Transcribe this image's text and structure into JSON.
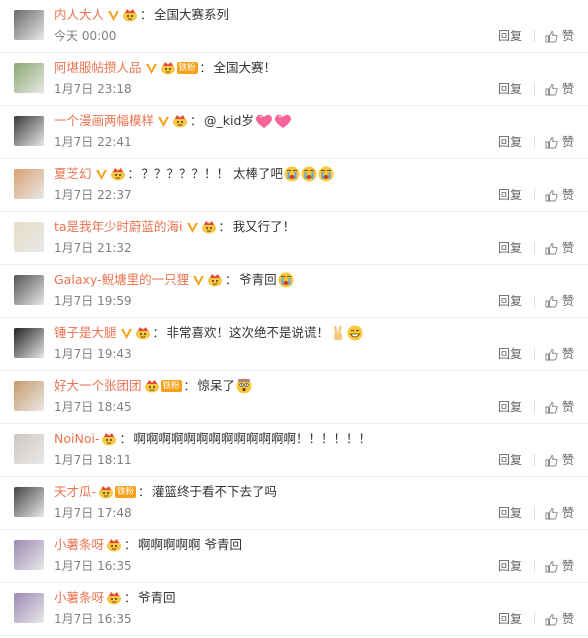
{
  "actions": {
    "reply_label": "回复",
    "like_label": "赞"
  },
  "colors": {
    "username": "#eb7350",
    "verified": "#f7a11b",
    "fan_badge": "#f7a11b"
  },
  "comments": [
    {
      "user": "内人大人",
      "verified": true,
      "crown": true,
      "fan_badge": "",
      "text": "全国大赛系列",
      "emojis": [],
      "time": "今天 00:00",
      "avatar_color": "#6b6b6b"
    },
    {
      "user": "阿堪服帖攒人品",
      "verified": true,
      "crown": true,
      "fan_badge": "铁粉",
      "text": "全国大赛！",
      "emojis": [],
      "time": "1月7日 23:18",
      "avatar_color": "#8aa86f"
    },
    {
      "user": "一个漫画两幅模样",
      "verified": true,
      "crown": true,
      "fan_badge": "",
      "text": "@_kid岁",
      "emojis": [
        "heart",
        "heart"
      ],
      "time": "1月7日 22:41",
      "avatar_color": "#3a3a3a"
    },
    {
      "user": "夏芝幻",
      "verified": true,
      "crown": true,
      "fan_badge": "",
      "text": "？？？？？！！ 太棒了吧",
      "emojis": [
        "cry",
        "cry",
        "cry"
      ],
      "time": "1月7日 22:37",
      "avatar_color": "#d9a070"
    },
    {
      "user": "ta是我年少时蔚蓝的海i",
      "verified": true,
      "crown": true,
      "fan_badge": "",
      "text": "我又行了！",
      "emojis": [],
      "time": "1月7日 21:32",
      "avatar_color": "#e6dcc6"
    },
    {
      "user": "Galaxy-鲵塘里的一只狸",
      "verified": true,
      "crown": true,
      "fan_badge": "",
      "text": "爷青回",
      "emojis": [
        "cry"
      ],
      "time": "1月7日 19:59",
      "avatar_color": "#555555"
    },
    {
      "user": "锤子是大腿",
      "verified": true,
      "crown": true,
      "fan_badge": "",
      "text": "非常喜欢！这次绝不是说谎！",
      "emojis": [
        "victory",
        "grin"
      ],
      "time": "1月7日 19:43",
      "avatar_color": "#222222"
    },
    {
      "user": "好大一个张团团",
      "verified": false,
      "crown": true,
      "fan_badge": "铁粉",
      "text": "惊呆了",
      "emojis": [
        "shock"
      ],
      "time": "1月7日 18:45",
      "avatar_color": "#c89a6a"
    },
    {
      "user": "NoiNoi-",
      "verified": false,
      "crown": true,
      "fan_badge": "",
      "text": "啊啊啊啊啊啊啊啊啊啊啊啊啊！！！！！！",
      "emojis": [],
      "time": "1月7日 18:11",
      "avatar_color": "#cfc8c0"
    },
    {
      "user": "天才瓜-",
      "verified": false,
      "crown": true,
      "fan_badge": "铁粉",
      "text": "灌篮终于看不下去了吗",
      "emojis": [],
      "time": "1月7日 17:48",
      "avatar_color": "#444444"
    },
    {
      "user": "小薯条呀",
      "verified": false,
      "crown": true,
      "fan_badge": "",
      "text": "啊啊啊啊啊  爷青回",
      "emojis": [],
      "time": "1月7日 16:35",
      "avatar_color": "#9c8ab5"
    },
    {
      "user": "小薯条呀",
      "verified": false,
      "crown": true,
      "fan_badge": "",
      "text": "爷青回",
      "emojis": [],
      "time": "1月7日 16:35",
      "avatar_color": "#9c8ab5"
    }
  ]
}
